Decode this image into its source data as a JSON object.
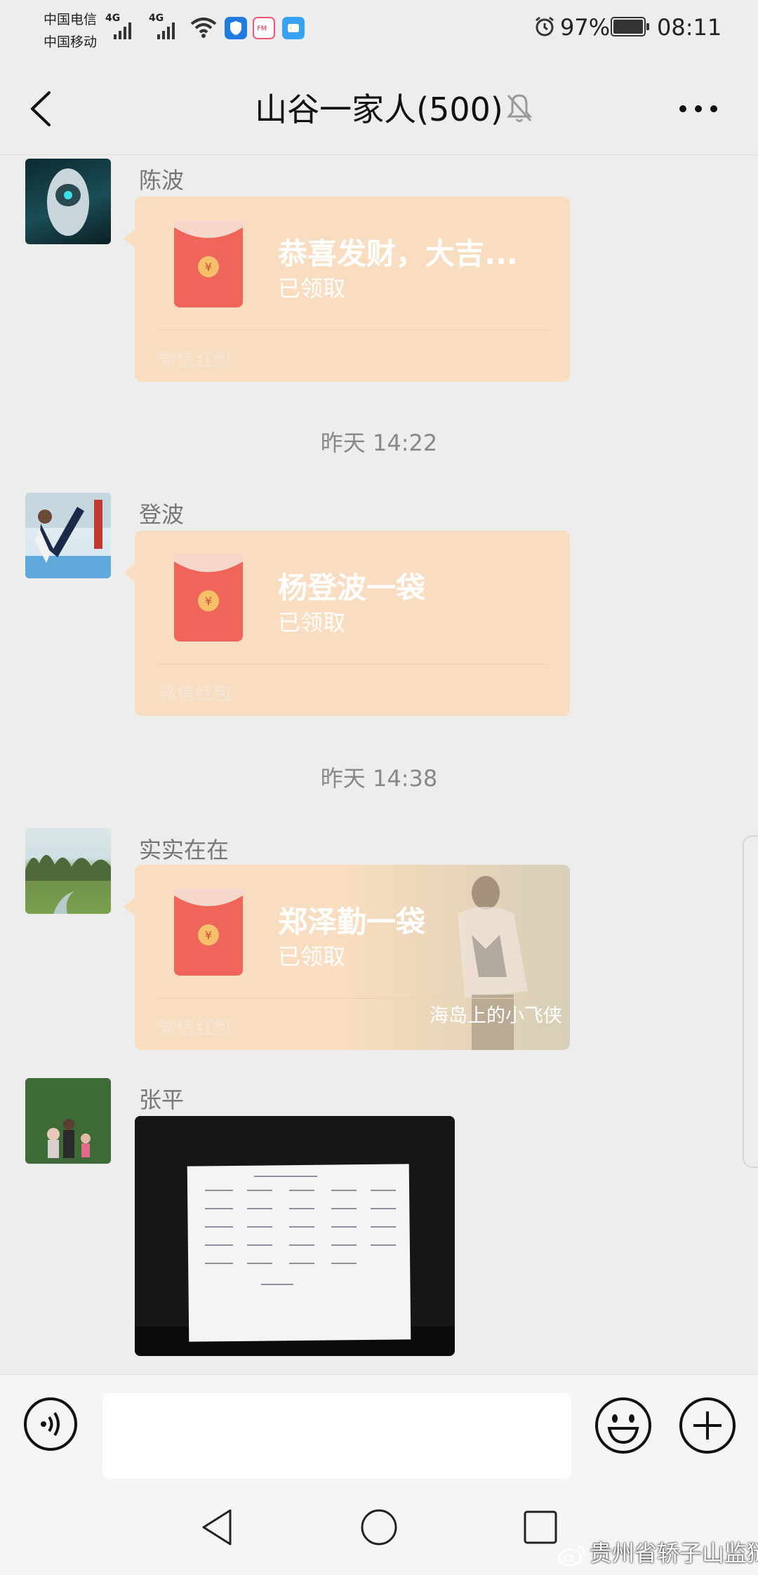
{
  "status_bar": {
    "carrier_1": "中国电信",
    "carrier_2": "中国移动",
    "network_1": "4G",
    "network_2": "4G",
    "battery": "97%",
    "time": "08:11",
    "icons": [
      "wifi-icon",
      "shield-app-icon",
      "fm-app-icon",
      "message-app-icon",
      "alarm-icon",
      "battery-icon"
    ]
  },
  "header": {
    "title": "山谷一家人(500)",
    "back_icon": "chevron-left-icon",
    "mute_icon": "bell-off-icon",
    "more_icon": "more-dots-icon"
  },
  "messages": [
    {
      "sender": "陈波",
      "type": "red-packet",
      "title": "恭喜发财，大吉...",
      "status": "已领取",
      "footer": "微信红包",
      "cover": ""
    },
    {
      "timestamp": "昨天 14:22"
    },
    {
      "sender": "登波",
      "type": "red-packet",
      "title": "杨登波一袋",
      "status": "已领取",
      "footer": "微信红包",
      "cover": ""
    },
    {
      "timestamp": "昨天 14:38"
    },
    {
      "sender": "实实在在",
      "type": "red-packet",
      "title": "郑泽勤一袋",
      "status": "已领取",
      "footer": "微信红包",
      "cover": "海岛上的小飞侠"
    },
    {
      "sender": "张平",
      "type": "image"
    }
  ],
  "input_bar": {
    "voice_icon": "voice-icon",
    "placeholder": "",
    "emoji_icon": "emoji-icon",
    "plus_icon": "plus-icon"
  },
  "nav_bar": {
    "icons": [
      "nav-back-icon",
      "nav-home-icon",
      "nav-recent-icon"
    ]
  },
  "watermark": "贵州省轿子山监狱",
  "colors": {
    "background": "#ededed",
    "red_packet": "#f9ddc0",
    "envelope": "#f0655a",
    "coin": "#f6c06a"
  }
}
